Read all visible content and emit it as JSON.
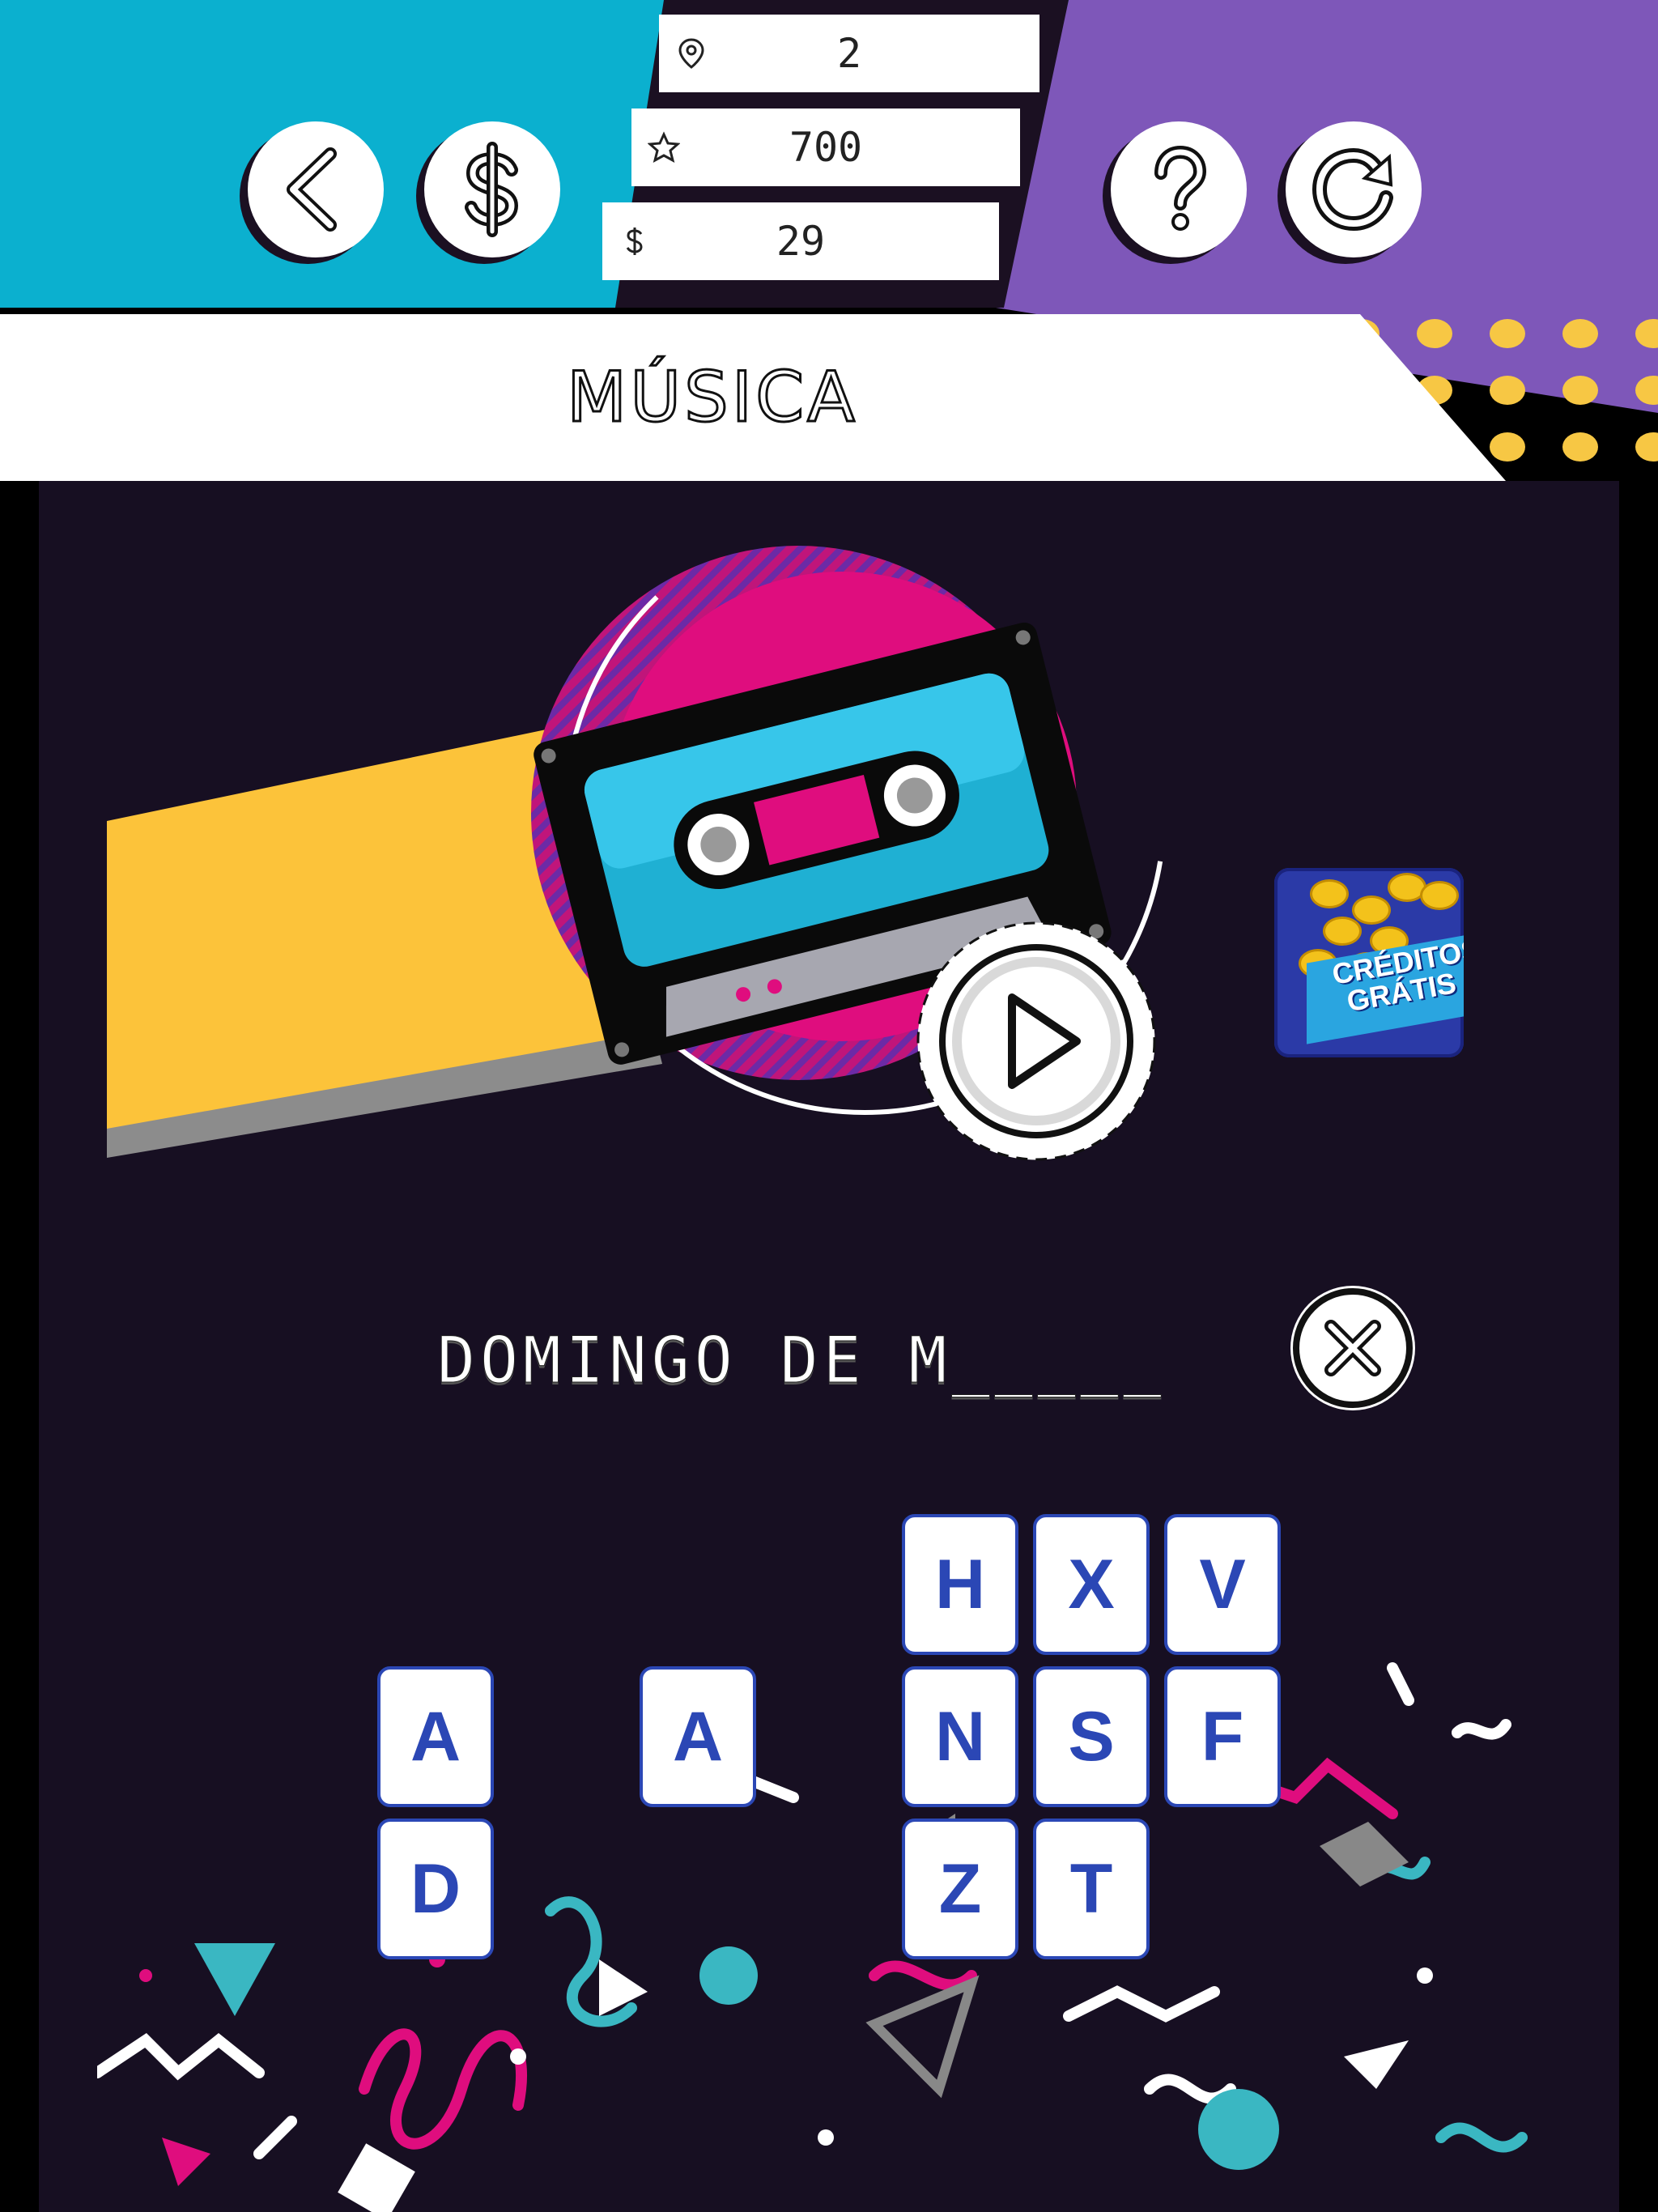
{
  "header": {
    "stats": [
      {
        "icon": "location-pin-icon",
        "value": "2"
      },
      {
        "icon": "star-icon",
        "value": "700"
      },
      {
        "icon": "dollar-icon",
        "value": "29"
      }
    ],
    "buttons": {
      "back": "back-arrow-icon",
      "coins": "dollar-icon",
      "help": "question-mark-icon",
      "restart": "restart-icon"
    }
  },
  "category": {
    "title": "MÚSICA"
  },
  "promo": {
    "line1": "CRÉDITOS",
    "line2": "GRÁTIS"
  },
  "answer": {
    "text": "DOMINGO DE M_____"
  },
  "tiles": {
    "top": [
      "H",
      "X",
      "V"
    ],
    "middle": [
      "A",
      "A",
      "N",
      "S",
      "F"
    ],
    "bottom": [
      "D",
      "Z",
      "T"
    ]
  },
  "colors": {
    "teal": "#0bb0cf",
    "purple": "#7e57b9",
    "panel": "#170f22",
    "yellow": "#f7c744",
    "pink": "#e0137c",
    "tile_blue": "#2b47b5"
  }
}
